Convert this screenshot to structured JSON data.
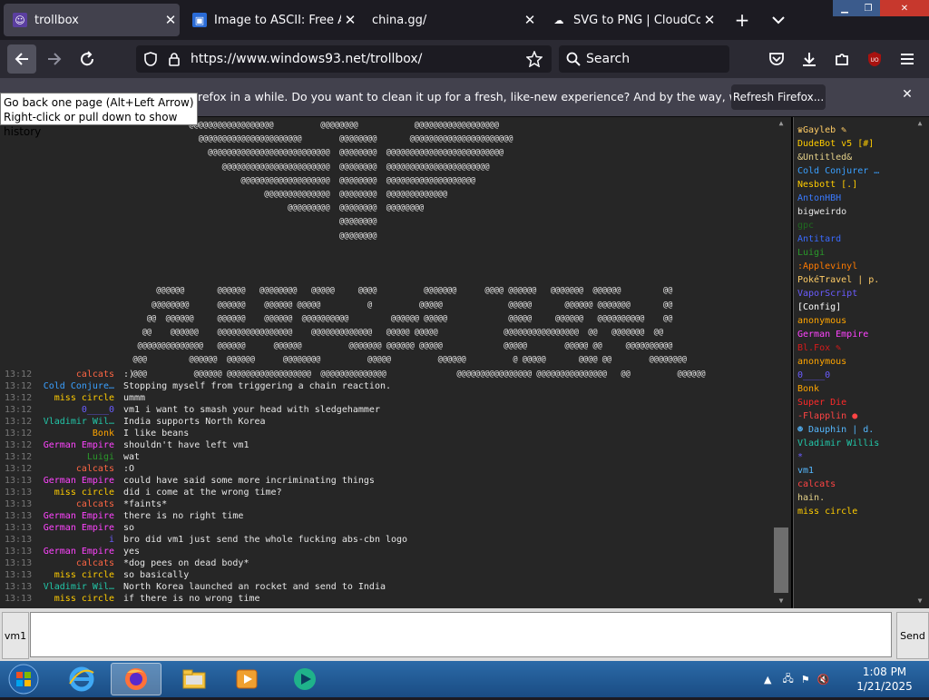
{
  "tabs": [
    {
      "title": "trollbox",
      "active": true
    },
    {
      "title": "Image to ASCII: Free ASCII",
      "active": false
    },
    {
      "title": "china.gg/",
      "active": false
    },
    {
      "title": "SVG to PNG | CloudConver",
      "active": false
    }
  ],
  "toolbar": {
    "url": "https://www.windows93.net/trollbox/",
    "search_placeholder": "Search"
  },
  "tooltip": {
    "line1": "Go back one page (Alt+Left Arrow)",
    "line2": "Right-click or pull down to show history"
  },
  "notification": {
    "text": "refox in a while. Do you want to clean it up for a fresh, like-new experience? And by the way, welcome back!",
    "button": "Refresh Firefox..."
  },
  "ascii_art": "              @@@@@@@@@@@@@@@@@@          @@@@@@@@            @@@@@@@@@@@@@@@@@@\n                @@@@@@@@@@@@@@@@@@@@@@        @@@@@@@@       @@@@@@@@@@@@@@@@@@@@@@\n                  @@@@@@@@@@@@@@@@@@@@@@@@@@  @@@@@@@@  @@@@@@@@@@@@@@@@@@@@@@@@@\n                     @@@@@@@@@@@@@@@@@@@@@@@  @@@@@@@@  @@@@@@@@@@@@@@@@@@@@@@\n                         @@@@@@@@@@@@@@@@@@@  @@@@@@@@  @@@@@@@@@@@@@@@@@@@\n                              @@@@@@@@@@@@@@  @@@@@@@@  @@@@@@@@@@@@@\n                                   @@@@@@@@@  @@@@@@@@  @@@@@@@@\n                                              @@@@@@@@\n                                              @@@@@@@@\n\n\n\n       @@@@@@       @@@@@@   @@@@@@@@   @@@@@     @@@@          @@@@@@@      @@@@ @@@@@@   @@@@@@@  @@@@@@         @@\n      @@@@@@@@      @@@@@@    @@@@@@ @@@@@          @          @@@@@              @@@@@       @@@@@@ @@@@@@@       @@\n     @@  @@@@@@     @@@@@@    @@@@@@  @@@@@@@@@@         @@@@@@ @@@@@             @@@@@     @@@@@@   @@@@@@@@@@    @@\n    @@    @@@@@@    @@@@@@@@@@@@@@@@    @@@@@@@@@@@@@   @@@@@ @@@@@              @@@@@@@@@@@@@@@@  @@   @@@@@@@  @@\n   @@@@@@@@@@@@@@   @@@@@@      @@@@@@          @@@@@@@ @@@@@@ @@@@@             @@@@@        @@@@@ @@     @@@@@@@@@@\n  @@@         @@@@@@  @@@@@@      @@@@@@@@          @@@@@          @@@@@@          @ @@@@@       @@@@ @@        @@@@@@@@\n  @@@          @@@@@@ @@@@@@@@@@@@@@@@@@  @@@@@@@@@@@@@@               @@@@@@@@@@@@@@@@ @@@@@@@@@@@@@@@   @@          @@@@@@",
  "messages": [
    {
      "time": "13:12",
      "nick": "calcats",
      "color": "#ff6644",
      "text": ":)"
    },
    {
      "time": "13:12",
      "nick": "Cold Conjure…",
      "color": "#3aa0ff",
      "text": "Stopping myself from triggering a chain reaction."
    },
    {
      "time": "13:12",
      "nick": "miss circle",
      "color": "#ffcc00",
      "text": "ummm"
    },
    {
      "time": "13:12",
      "nick": "0____0",
      "color": "#6a5cff",
      "text": "vm1 i want to smash your head with sledgehammer"
    },
    {
      "time": "13:12",
      "nick": "Vladimir Wil…",
      "color": "#22c7a9",
      "text": "India supports North Korea"
    },
    {
      "time": "13:12",
      "nick": "Bonk",
      "color": "#ffa500",
      "text": "I like beans"
    },
    {
      "time": "13:12",
      "nick": "German Empire",
      "color": "#ff44ff",
      "text": "shouldn't have left vm1"
    },
    {
      "time": "13:12",
      "nick": "Luigi",
      "color": "#2a9a2a",
      "text": "wat"
    },
    {
      "time": "13:12",
      "nick": "calcats",
      "color": "#ff6644",
      "text": ":O"
    },
    {
      "time": "13:13",
      "nick": "German Empire",
      "color": "#ff44ff",
      "text": "could have said some more incriminating things"
    },
    {
      "time": "13:13",
      "nick": "miss circle",
      "color": "#ffcc00",
      "text": "did i come at the wrong time?"
    },
    {
      "time": "13:13",
      "nick": "calcats",
      "color": "#ff6644",
      "text": "*faints*"
    },
    {
      "time": "13:13",
      "nick": "German Empire",
      "color": "#ff44ff",
      "text": "there is no right time"
    },
    {
      "time": "13:13",
      "nick": "German Empire",
      "color": "#ff44ff",
      "text": "so"
    },
    {
      "time": "13:13",
      "nick": "i",
      "color": "#6a5cff",
      "text": "bro did vm1 just send the whole fucking abs-cbn logo"
    },
    {
      "time": "13:13",
      "nick": "German Empire",
      "color": "#ff44ff",
      "text": "yes"
    },
    {
      "time": "13:13",
      "nick": "calcats",
      "color": "#ff6644",
      "text": "*dog pees on dead body*"
    },
    {
      "time": "13:13",
      "nick": "miss circle",
      "color": "#ffcc00",
      "text": "so basically"
    },
    {
      "time": "13:13",
      "nick": "Vladimir Wil…",
      "color": "#22c7a9",
      "text": "North Korea launched an rocket and send to India"
    },
    {
      "time": "13:13",
      "nick": "miss circle",
      "color": "#ffcc00",
      "text": "if there is no wrong time"
    }
  ],
  "users": [
    {
      "name": "♛Gayleb ✎",
      "color": "#ffcc66"
    },
    {
      "name": "DudeBot v5 [#]",
      "color": "#ffcc00"
    },
    {
      "name": "&Untitled&",
      "color": "#e6d28a"
    },
    {
      "name": "Cold Conjurer …",
      "color": "#3aa0ff"
    },
    {
      "name": "Nesbott [.]",
      "color": "#ffcc00"
    },
    {
      "name": "AntonHBH",
      "color": "#3a7aff"
    },
    {
      "name": "bigweirdo",
      "color": "#e6e6e6"
    },
    {
      "name": "gpc",
      "color": "#1f6a1f"
    },
    {
      "name": "Antitard",
      "color": "#3a6aff"
    },
    {
      "name": "Luigi",
      "color": "#2a9a2a"
    },
    {
      "name": ":Applevinyl",
      "color": "#ff7a00"
    },
    {
      "name": "PokéTravel | p.",
      "color": "#ffcc66"
    },
    {
      "name": "VaporScript",
      "color": "#6a5cff"
    },
    {
      "name": "[Config]",
      "color": "#ffffff"
    },
    {
      "name": "anonymous",
      "color": "#ffa500"
    },
    {
      "name": "German Empire",
      "color": "#ff44ff"
    },
    {
      "name": "Bl.Fox ✎",
      "color": "#d81b1b"
    },
    {
      "name": "anonymous",
      "color": "#ffa500"
    },
    {
      "name": "0____0",
      "color": "#6a5cff"
    },
    {
      "name": "Bonk",
      "color": "#ffa500"
    },
    {
      "name": "Super Die",
      "color": "#ff2a2a"
    },
    {
      "name": "-Flapplin ●",
      "color": "#ff4444"
    },
    {
      "name": "☻ Dauphin | d.",
      "color": "#55b8ff"
    },
    {
      "name": "Vladimir Willis",
      "color": "#22c7a9"
    },
    {
      "name": "*",
      "color": "#6a5cff"
    },
    {
      "name": "vm1",
      "color": "#55b8ff"
    },
    {
      "name": "calcats",
      "color": "#ff4444"
    },
    {
      "name": "hain.",
      "color": "#e6d28a"
    },
    {
      "name": "miss circle",
      "color": "#ffcc00"
    }
  ],
  "input": {
    "nick_label": "vm1",
    "send_label": "Send"
  },
  "taskbar": {
    "time": "1:08 PM",
    "date": "1/21/2025"
  }
}
